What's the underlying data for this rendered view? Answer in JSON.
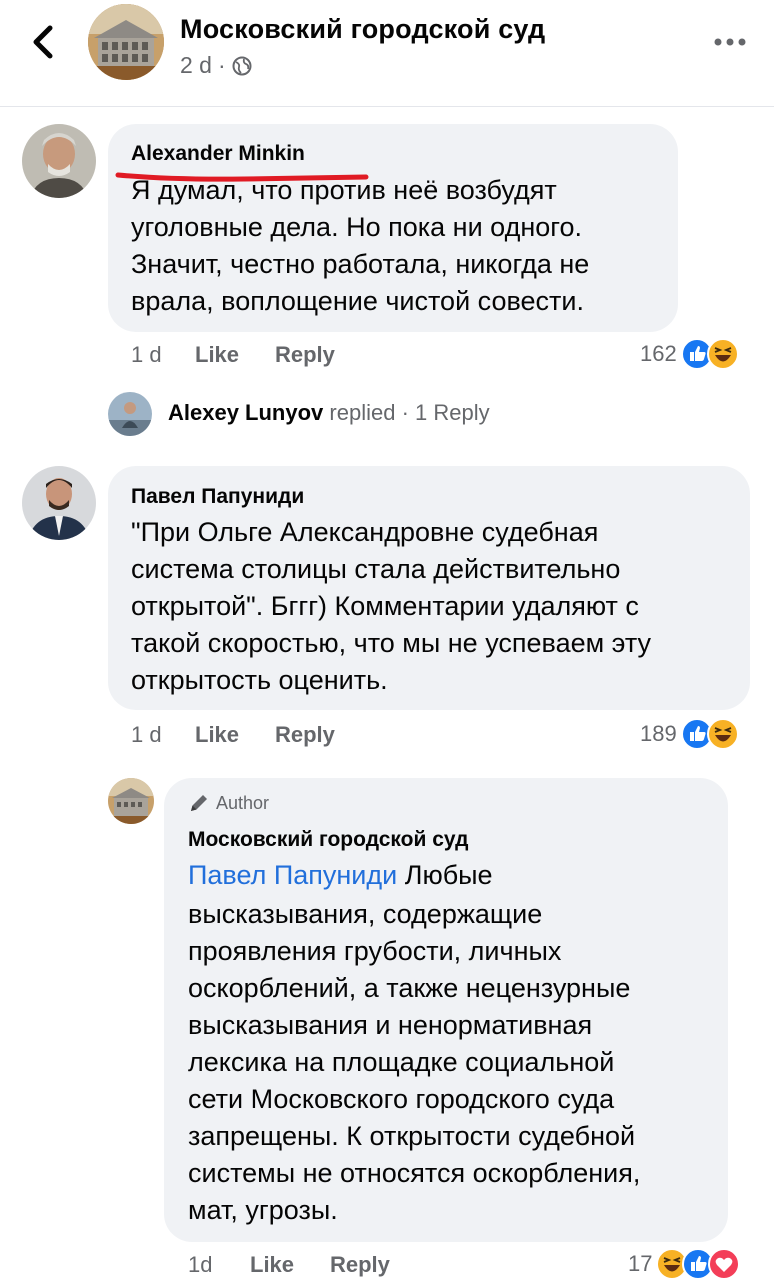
{
  "header": {
    "title": "Московский городской суд",
    "time": "2 d",
    "dot": "·"
  },
  "comments": [
    {
      "author": "Alexander  Minkin",
      "lines": [
        "Я думал, что против неё возбудят",
        "уголовные дела. Но пока ни одного.",
        "Значит, честно работала, никогда не",
        "врала, воплощение чистой совести."
      ],
      "time": "1 d",
      "like": "Like",
      "reply": "Reply",
      "reactions_count": "162",
      "reactions": [
        "like-reaction-icon",
        "haha-reaction-icon"
      ],
      "replies_summary": {
        "name": "Alexey  Lunyov",
        "action": "replied",
        "count": "· 1 Reply"
      }
    },
    {
      "author": "Павел Папуниди",
      "lines": [
        "\"При Ольге Александровне судебная",
        "система столицы стала действительно",
        "открытой\". Бггг) Комментарии удаляют с",
        "такой скоростью, что мы не успеваем эту",
        "открытость оценить."
      ],
      "time": "1 d",
      "like": "Like",
      "reply": "Reply",
      "reactions_count": "189",
      "reactions": [
        "like-reaction-icon",
        "haha-reaction-icon"
      ]
    }
  ],
  "author_reply": {
    "badge": "Author",
    "author": "Московский городской суд",
    "mention": "Павел Папуниди",
    "first_line_rest": " Любые",
    "lines": [
      "высказывания, содержащие",
      "проявления грубости, личных",
      "оскорблений, а также нецензурные",
      "высказывания и ненормативная",
      "лексика на площадке социальной",
      "сети Московского городского суда",
      "запрещены. К открытости судебной",
      "системы не относятся оскорбления,",
      "мат, угрозы."
    ],
    "time": "1d",
    "like": "Like",
    "reply": "Reply",
    "reactions_count": "17",
    "reactions": [
      "haha-reaction-icon",
      "like-reaction-icon",
      "love-reaction-icon"
    ]
  },
  "colors": {
    "like_blue": "#1877f2",
    "haha_yellow": "#f7b125",
    "love_red": "#f33e58",
    "mention_blue": "#216fdb",
    "annotation_red": "#e01b24"
  }
}
